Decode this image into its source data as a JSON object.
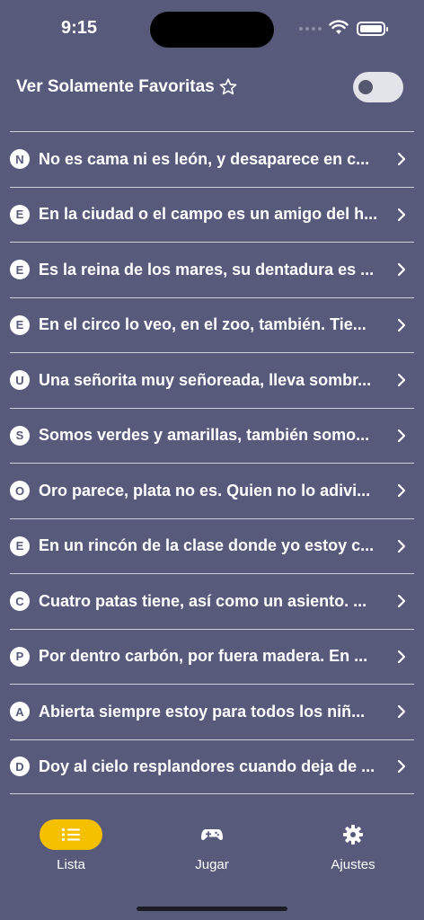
{
  "status_bar": {
    "time": "9:15"
  },
  "header": {
    "title": "Ver Solamente Favoritas",
    "favorites_only": false
  },
  "riddles": [
    {
      "letter": "N",
      "text": "No es cama ni es león, y desaparece en c..."
    },
    {
      "letter": "E",
      "text": "En la ciudad o el campo es un amigo del h..."
    },
    {
      "letter": "E",
      "text": "Es la reina de los mares, su dentadura es ..."
    },
    {
      "letter": "E",
      "text": "En el circo lo veo, en el zoo, también. Tie..."
    },
    {
      "letter": "U",
      "text": "Una señorita muy señoreada, lleva sombr..."
    },
    {
      "letter": "S",
      "text": "Somos verdes y amarillas, también somo..."
    },
    {
      "letter": "O",
      "text": "Oro parece, plata no es. Quien no lo adivi..."
    },
    {
      "letter": "E",
      "text": "En un rincón de la clase donde yo estoy c..."
    },
    {
      "letter": "C",
      "text": "Cuatro patas tiene, así como un asiento. ..."
    },
    {
      "letter": "P",
      "text": "Por dentro carbón, por fuera madera. En ..."
    },
    {
      "letter": "A",
      "text": "Abierta siempre estoy para todos los niñ..."
    },
    {
      "letter": "D",
      "text": "Doy al cielo resplandores cuando deja de ..."
    }
  ],
  "tabs": [
    {
      "label": "Lista",
      "icon": "list-icon",
      "active": true
    },
    {
      "label": "Jugar",
      "icon": "gamepad-icon",
      "active": false
    },
    {
      "label": "Ajustes",
      "icon": "gear-icon",
      "active": false
    }
  ],
  "colors": {
    "background": "#585a7c",
    "accent": "#f5c000",
    "text": "#ffffff"
  }
}
